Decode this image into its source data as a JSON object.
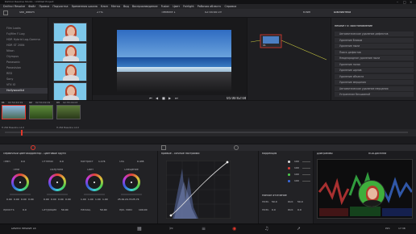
{
  "titlebar": {
    "title": "DaVinci Resolve Studio - Untitled Project"
  },
  "menu": [
    "DaVinci Resolve",
    "Файл",
    "Правка",
    "Подчистка",
    "Временная шкала",
    "Клип",
    "Метка",
    "Вид",
    "Воспроизведение",
    "Fusion",
    "Цвет",
    "Fairlight",
    "Рабочая область",
    "Справка"
  ],
  "toolbar": {
    "album": "Still_album",
    "zoom": "27%",
    "timeline": "Timeline 1",
    "timecode": "02:54:40:19",
    "project": "Untitled Project",
    "status": "Сохранено",
    "clip_tab": "Клип",
    "library_tab": "Библиотека"
  },
  "lut_list": {
    "items": [
      "Film Looks",
      "Fujifilm F-Log",
      "HDR Hybrid Log-Gamma",
      "HDR ST 2084",
      "Nikon",
      "Olympus",
      "Panasonic",
      "Panavision",
      "RED",
      "Sony",
      "VFX IO",
      "Hollywoodlut"
    ],
    "selected": "Hollywoodlut"
  },
  "thumbs": [
    {
      "caption": ""
    },
    {
      "caption": ""
    },
    {
      "caption": ""
    },
    {
      "caption": "Не задано"
    }
  ],
  "viewer": {
    "timecode": "05:00:02:04"
  },
  "nodes": {
    "node_label": "01"
  },
  "library": {
    "title": "Resolve FX: Восстановление",
    "items": [
      "Автоматическое удаление дефектов",
      "Удаление бликов",
      "Удаление пыли",
      "Поиск дефектов",
      "Неоднородное удаление пыли",
      "Удаление полос",
      "Удаление шумов",
      "Удаление объекта",
      "Удаление мерцания",
      "Автоматическое удаление мерцания",
      "Устранение бесшовной"
    ]
  },
  "timeline": {
    "clips": [
      {
        "id": "01",
        "tc": "02:54:40:19",
        "label": "H.264 Baseline L4.0"
      },
      {
        "id": "02",
        "tc": "02:54:49:19",
        "label": ""
      },
      {
        "id": "03",
        "tc": "02:55:09:03",
        "label": "H.264 Baseline L4.0"
      }
    ]
  },
  "wheels": {
    "mode": "Первичный цветокорректор - Цветовые круги",
    "row1": [
      {
        "label": "Темп.",
        "value": "0.0"
      },
      {
        "label": "Оттенок",
        "value": "0.0"
      },
      {
        "label": "Контраст",
        "value": "1.174"
      },
      {
        "label": "Ось",
        "value": "0.435"
      }
    ],
    "wheels": [
      {
        "name": "Тени",
        "values": [
          "0.00",
          "0.00",
          "0.00",
          "0.00"
        ]
      },
      {
        "name": "Полутона",
        "values": [
          "0.00",
          "0.00",
          "0.00",
          "0.00"
        ]
      },
      {
        "name": "Свет",
        "values": [
          "1.00",
          "1.00",
          "1.00",
          "1.00"
        ]
      },
      {
        "name": "Смещение",
        "values": [
          "25.61",
          "24.72",
          "25.74",
          ""
        ]
      }
    ],
    "row3": [
      {
        "label": "Яркость",
        "value": "0.0"
      },
      {
        "label": "Сатурация",
        "value": "50.00"
      },
      {
        "label": "Насыщ.",
        "value": "50.00"
      },
      {
        "label": "Ярк. микс",
        "value": "100.00"
      }
    ]
  },
  "curves": {
    "title": "Кривые - Личные настройки"
  },
  "mixer": {
    "title": "Коррекция",
    "values": [
      "100",
      "100",
      "100",
      "100"
    ],
    "soft_title": "Мягкое отсечение",
    "soft": [
      {
        "label": "Низк.",
        "value": "50.0"
      },
      {
        "label": "Выс.",
        "value": "50.0"
      },
      {
        "label": "Низк.",
        "value": "0.0"
      },
      {
        "label": "Выс.",
        "value": "0.0"
      }
    ]
  },
  "scopes": {
    "title": "Диаграммы",
    "mode": "RGB-дисплей"
  },
  "pagebar": {
    "app": "DaVinci Resolve 18",
    "clock": "17:38",
    "lang": "РУС"
  },
  "colors": {
    "accent": "#e2382c",
    "highlight": "#f0c43a",
    "curve": "#e0e0e0"
  }
}
